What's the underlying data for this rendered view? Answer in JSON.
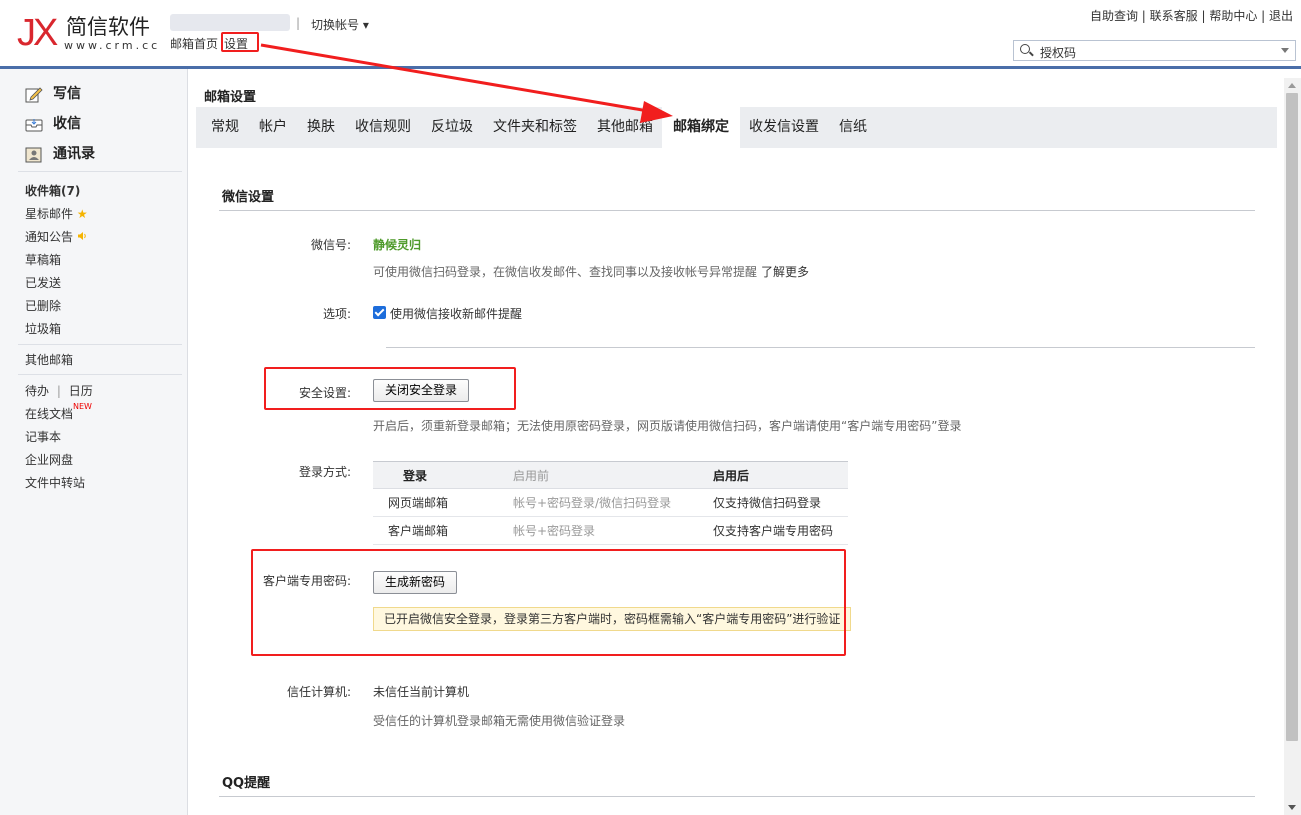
{
  "logo": {
    "mark": "JX",
    "name": "简信软件",
    "url": "www.crm.cc"
  },
  "header": {
    "separator": "|",
    "switch_account": "切换帐号",
    "nav": [
      "邮箱首页",
      "设置"
    ],
    "right_links": "自助查询 | 联系客服 | 帮助中心 | 退出",
    "search_value": "授权码"
  },
  "sidebar": {
    "compose": "写信",
    "inbox_main": "收信",
    "contacts": "通讯录",
    "folders": [
      "收件箱(7)",
      "星标邮件",
      "通知公告",
      "草稿箱",
      "已发送",
      "已删除",
      "垃圾箱"
    ],
    "other_mail": "其他邮箱",
    "todo": "待办",
    "todo_sep": "|",
    "calendar": "日历",
    "online_docs": "在线文档",
    "new_badge": "NEW",
    "notes": "记事本",
    "drive": "企业网盘",
    "transfer": "文件中转站"
  },
  "main": {
    "title": "邮箱设置",
    "tabs": [
      "常规",
      "帐户",
      "换肤",
      "收信规则",
      "反垃圾",
      "文件夹和标签",
      "其他邮箱",
      "邮箱绑定",
      "收发信设置",
      "信纸"
    ],
    "active_tab": "邮箱绑定",
    "wechat": {
      "section_title": "微信设置",
      "id_label": "微信号:",
      "id_value": "静候灵归",
      "id_desc": "可使用微信扫码登录，在微信收发邮件、查找同事以及接收帐号异常提醒",
      "learn_more": "了解更多",
      "option_label": "选项:",
      "option_text": "使用微信接收新邮件提醒",
      "security_label": "安全设置:",
      "security_button": "关闭安全登录",
      "security_desc": "开启后，须重新登录邮箱；无法使用原密码登录，网页版请使用微信扫码，客户端请使用“客户端专用密码”登录",
      "login_label": "登录方式:",
      "login_table": {
        "headers": [
          "登录",
          "启用前",
          "启用后"
        ],
        "rows": [
          [
            "网页端邮箱",
            "帐号+密码登录/微信扫码登录",
            "仅支持微信扫码登录"
          ],
          [
            "客户端邮箱",
            "帐号+密码登录",
            "仅支持客户端专用密码"
          ]
        ]
      },
      "client_pwd_label": "客户端专用密码:",
      "client_pwd_button": "生成新密码",
      "client_pwd_tip": "已开启微信安全登录，登录第三方客户端时，密码框需输入“客户端专用密码”进行验证",
      "trusted_label": "信任计算机:",
      "trusted_value": "未信任当前计算机",
      "trusted_desc": "受信任的计算机登录邮箱无需使用微信验证登录"
    },
    "qq_section_title": "QQ提醒"
  },
  "colors": {
    "accent": "#4a6ea9",
    "annotation_red": "#f11e1e",
    "wechat_green": "#4e9a2a"
  }
}
